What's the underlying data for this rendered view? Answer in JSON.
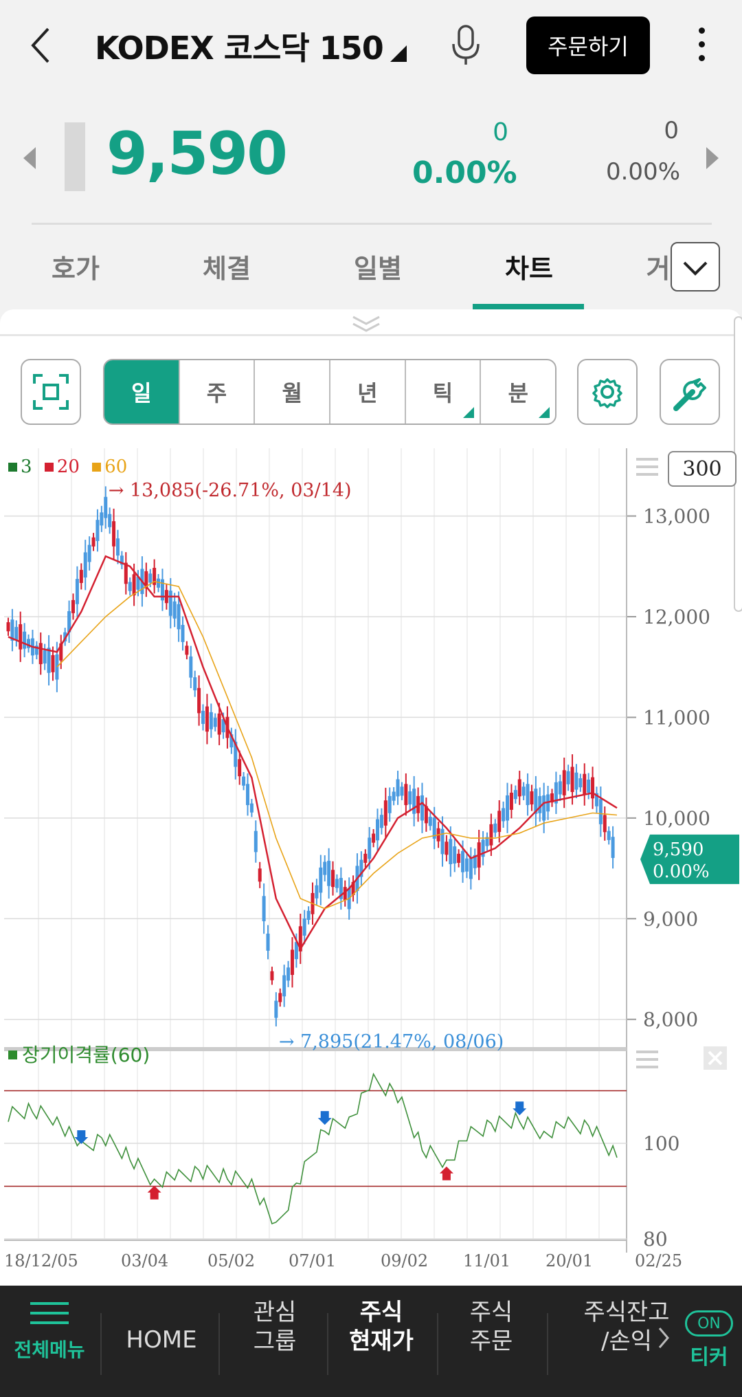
{
  "header": {
    "title": "KODEX 코스닥 150",
    "order_button": "주문하기"
  },
  "quote": {
    "price": "9,590",
    "change": "0",
    "change_pct": "0.00%",
    "change2": "0",
    "change_pct2": "0.00%"
  },
  "tabs": [
    {
      "label": "호가"
    },
    {
      "label": "체결"
    },
    {
      "label": "일별"
    },
    {
      "label": "차트",
      "active": true
    },
    {
      "label": "거"
    }
  ],
  "periods": [
    {
      "label": "일",
      "active": true
    },
    {
      "label": "주"
    },
    {
      "label": "월"
    },
    {
      "label": "년"
    },
    {
      "label": "틱"
    },
    {
      "label": "분"
    }
  ],
  "chart_controls": {
    "period_count": "300"
  },
  "colors": {
    "accent": "#14a085",
    "ma3": "#1d7a2e",
    "ma20": "#d42030",
    "ma60": "#e8a317",
    "candle": "#4a9ae0",
    "indicator_line": "#3d8f3a",
    "band_line": "#a02020"
  },
  "chart_data": [
    {
      "type": "line",
      "legend": [
        {
          "label": "3",
          "color": "#1d7a2e"
        },
        {
          "label": "20",
          "color": "#d42030"
        },
        {
          "label": "60",
          "color": "#e8a317"
        }
      ],
      "annotations": {
        "high": "13,085(-26.71%, 03/14)",
        "low": "7,895(21.47%, 08/06)"
      },
      "current_price_label": "9,590",
      "current_pct_label": "0.00%",
      "ylim": [
        7800,
        13400
      ],
      "yticks": [
        "13,000",
        "12,000",
        "11,000",
        "10,000",
        "9,000",
        "8,000"
      ],
      "xticks": [
        "18/12/05",
        "03/04",
        "05/02",
        "07/01",
        "09/02",
        "11/01",
        "20/01",
        "02/25"
      ],
      "x_dates": [
        "18/12/05",
        "19/01/03",
        "19/01/31",
        "19/03/04",
        "19/03/14",
        "19/04/01",
        "19/05/02",
        "19/05/20",
        "19/06/03",
        "19/07/01",
        "19/07/22",
        "19/08/06",
        "19/08/26",
        "19/09/02",
        "19/09/20",
        "19/10/01",
        "19/10/15",
        "19/11/01",
        "19/11/20",
        "19/12/02",
        "19/12/16",
        "20/01/02",
        "20/01/20",
        "20/02/03",
        "20/02/18",
        "20/02/25"
      ],
      "series": [
        {
          "name": "3",
          "values": [
            11900,
            11700,
            11500,
            12400,
            13085,
            12300,
            12400,
            12000,
            11000,
            10900,
            10100,
            8100,
            8800,
            9500,
            9200,
            9800,
            10300,
            10100,
            9700,
            9500,
            9900,
            10300,
            10100,
            10400,
            10300,
            9590
          ]
        },
        {
          "name": "20",
          "values": [
            11800,
            11700,
            11650,
            12050,
            12600,
            12500,
            12200,
            12200,
            11500,
            10900,
            10400,
            9200,
            8700,
            9100,
            9300,
            9600,
            10000,
            10150,
            9900,
            9600,
            9700,
            9900,
            10150,
            10200,
            10250,
            10100
          ]
        },
        {
          "name": "60",
          "values": [
            null,
            null,
            11500,
            11750,
            12000,
            12200,
            12350,
            12300,
            11800,
            11200,
            10600,
            9800,
            9200,
            9100,
            9200,
            9450,
            9650,
            9800,
            9850,
            9800,
            9800,
            9850,
            9950,
            10000,
            10050,
            10030
          ]
        }
      ]
    },
    {
      "type": "line",
      "legend": [
        {
          "label": "장기이격률(60)",
          "color": "#2e8b2e"
        }
      ],
      "ylim": [
        80,
        120
      ],
      "yticks": [
        "100",
        "80"
      ],
      "band_lines": [
        111,
        91
      ],
      "series": [
        {
          "name": "장기이격률(60)",
          "values": [
            106,
            107,
            105,
            99,
            101,
            97,
            92,
            93,
            94,
            93,
            92,
            82,
            93,
            103,
            105,
            113,
            110,
            99,
            96,
            102,
            104,
            105,
            102,
            104,
            103,
            97
          ]
        }
      ]
    }
  ],
  "bottom_nav": [
    {
      "label": "전체메뉴",
      "icon": "menu-icon"
    },
    {
      "label": "HOME"
    },
    {
      "label": "관심\n그룹"
    },
    {
      "label": "주식\n현재가",
      "active": true
    },
    {
      "label": "주식\n주문"
    },
    {
      "label": "주식잔고\n/손익"
    },
    {
      "label": "티커",
      "badge": "ON"
    }
  ]
}
